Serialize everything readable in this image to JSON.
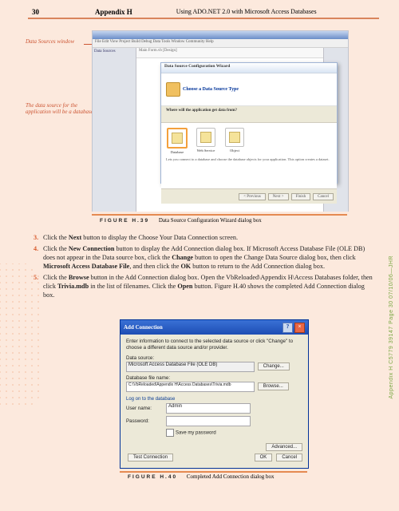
{
  "header": {
    "page_number": "30",
    "appendix": "Appendix H",
    "chapter": "Using ADO.NET 2.0 with Microsoft Access Databases"
  },
  "callouts": {
    "c1": "Data Sources window",
    "c2": "The data source for the application will be a database"
  },
  "screenshot1": {
    "menu": "File Edit View Project Build Debug Data Tools Window Community Help",
    "side_panel_title": "Data Sources",
    "tab": "Main Form.vb [Design]",
    "wizard_title": "Data Source Configuration Wizard",
    "wizard_heading": "Choose a Data Source Type",
    "wizard_question": "Where will the application get data from?",
    "options": {
      "o1": "Database",
      "o2": "Web Service",
      "o3": "Object"
    },
    "wizard_desc": "Lets you connect to a database and choose the database objects for your application. This option creates a dataset.",
    "btn_prev": "< Previous",
    "btn_next": "Next >",
    "btn_finish": "Finish",
    "btn_cancel": "Cancel"
  },
  "figure1": {
    "label": "FIGURE H.39",
    "caption": "Data Source Configuration Wizard dialog box"
  },
  "steps": {
    "s3": {
      "num": "3.",
      "text_a": "Click the ",
      "bold_a": "Next",
      "text_b": " button to display the Choose Your Data Connection screen."
    },
    "s4": {
      "num": "4.",
      "text_a": "Click the ",
      "bold_a": "New Connection",
      "text_b": " button to display the Add Connection dialog box. If Microsoft Access Database File (OLE DB) does not appear in the Data source box, click the ",
      "bold_b": "Change",
      "text_c": " button to open the Change Data Source dialog box, then click ",
      "bold_c": "Microsoft Access Database File",
      "text_d": ", and then click the ",
      "bold_d": "OK",
      "text_e": " button to return to the Add Connection dialog box."
    },
    "s5": {
      "num": "5.",
      "text_a": "Click the ",
      "bold_a": "Browse",
      "text_b": " button in the Add Connection dialog box. Open the VbReloaded\\Appendix H\\Access Databases folder, then click ",
      "bold_b": "Trivia.mdb",
      "text_c": " in the list of filenames. Click the ",
      "bold_c": "Open",
      "text_d": " button. Figure H.40 shows the completed Add Connection dialog box."
    }
  },
  "dialog2": {
    "title": "Add Connection",
    "hint": "Enter information to connect to the selected data source or click \"Change\" to choose a different data source and/or provider.",
    "lbl_datasource": "Data source:",
    "val_datasource": "Microsoft Access Database File (OLE DB)",
    "btn_change": "Change...",
    "lbl_dbfile": "Database file name:",
    "val_dbfile": "C:\\VbReloaded\\Appendix H\\Access Databases\\Trivia.mdb",
    "btn_browse": "Browse...",
    "sec_logon": "Log on to the database",
    "lbl_user": "User name:",
    "val_user": "Admin",
    "lbl_pass": "Password:",
    "chk_save": "Save my password",
    "btn_advanced": "Advanced...",
    "btn_test": "Test Connection",
    "btn_ok": "OK",
    "btn_cancel": "Cancel"
  },
  "figure2": {
    "label": "FIGURE H.40",
    "caption": "Completed Add Connection dialog box"
  },
  "sidetext": "Appendix H  C5779  39147  Page 30  07/10/06—JHR"
}
